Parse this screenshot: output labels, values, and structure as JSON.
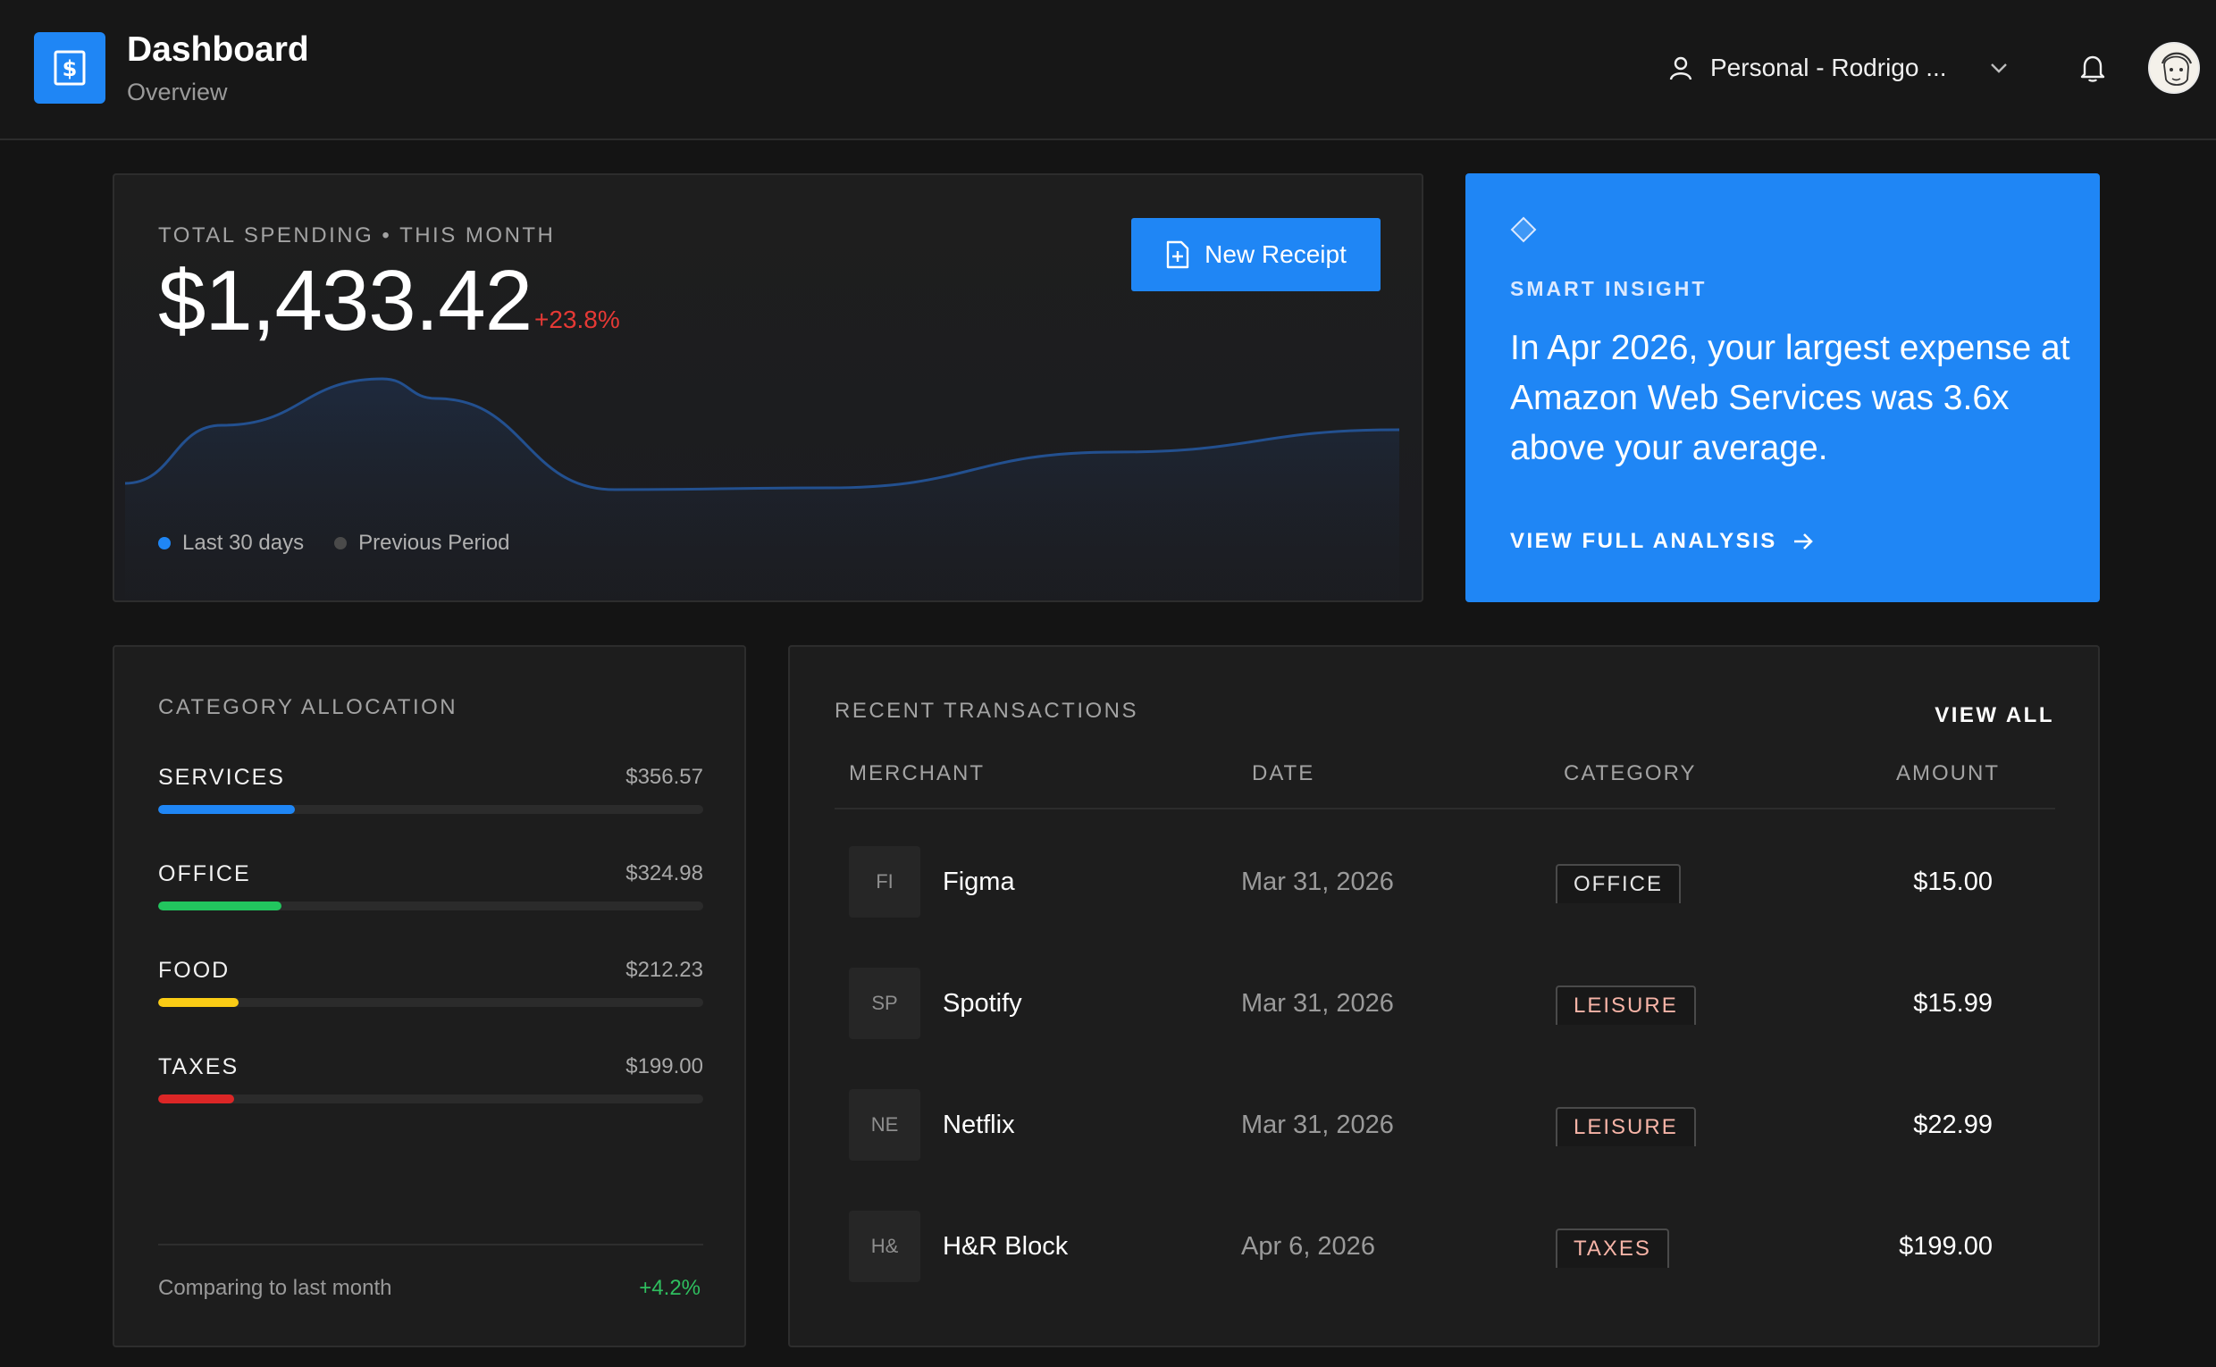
{
  "header": {
    "title": "Dashboard",
    "subtitle": "Overview",
    "account_label": "Personal - Rodrigo ...",
    "logo_icon": "receipt-dollar-icon"
  },
  "spending": {
    "eyebrow": "TOTAL SPENDING • THIS MONTH",
    "amount": "$1,433.42",
    "delta": "+23.8%",
    "new_receipt_label": "New Receipt",
    "legend": [
      {
        "label": "Last 30 days",
        "color": "#1f86f5"
      },
      {
        "label": "Previous Period",
        "color": "#4a4a4a"
      }
    ]
  },
  "chart_data": {
    "type": "area",
    "series": [
      {
        "name": "Last 30 days",
        "values": [
          0.22,
          0.78,
          0.78,
          0.23,
          0.26,
          0.43,
          0.6
        ]
      }
    ],
    "x": [
      0,
      1,
      2,
      3,
      4,
      5,
      6
    ],
    "grid": false,
    "legend_position": "bottom-left"
  },
  "insight": {
    "kicker": "SMART INSIGHT",
    "message": "In Apr 2026, your largest expense at Amazon Web Services was 3.6x above your average.",
    "cta": "VIEW FULL ANALYSIS"
  },
  "categories": {
    "eyebrow": "CATEGORY ALLOCATION",
    "items": [
      {
        "name": "SERVICES",
        "value": "$356.57",
        "fraction": 0.25,
        "color": "#1f86f5"
      },
      {
        "name": "OFFICE",
        "value": "$324.98",
        "fraction": 0.227,
        "color": "#22c55e"
      },
      {
        "name": "FOOD",
        "value": "$212.23",
        "fraction": 0.148,
        "color": "#facc15"
      },
      {
        "name": "TAXES",
        "value": "$199.00",
        "fraction": 0.139,
        "color": "#dc2626"
      }
    ],
    "compare_label": "Comparing to last month",
    "compare_value": "+4.2%"
  },
  "transactions": {
    "eyebrow": "RECENT TRANSACTIONS",
    "view_all": "VIEW ALL",
    "columns": [
      "MERCHANT",
      "DATE",
      "CATEGORY",
      "AMOUNT"
    ],
    "rows": [
      {
        "initials": "FI",
        "merchant": "Figma",
        "date": "Mar 31, 2026",
        "category": "OFFICE",
        "category_color": "#e6e6e6",
        "amount": "$15.00"
      },
      {
        "initials": "SP",
        "merchant": "Spotify",
        "date": "Mar 31, 2026",
        "category": "LEISURE",
        "category_color": "#f7b4a7",
        "amount": "$15.99"
      },
      {
        "initials": "NE",
        "merchant": "Netflix",
        "date": "Mar 31, 2026",
        "category": "LEISURE",
        "category_color": "#f7b4a7",
        "amount": "$22.99"
      },
      {
        "initials": "H&",
        "merchant": "H&R Block",
        "date": "Apr 6, 2026",
        "category": "TAXES",
        "category_color": "#f7b4a7",
        "amount": "$199.00"
      }
    ]
  }
}
